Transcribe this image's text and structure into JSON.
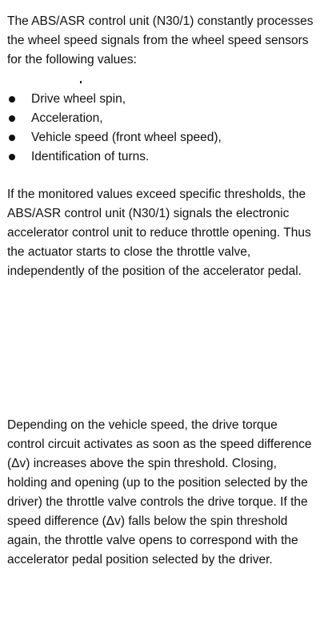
{
  "document": {
    "intro": "The ABS/ASR control unit (N30/1) constantly processes the wheel speed signals from the wheel speed sensors for the following values:",
    "bullets": [
      "Drive wheel spin,",
      "Acceleration,",
      "Vehicle speed (front wheel speed),",
      "Identification of turns."
    ],
    "paragraph2": "If the monitored values exceed specific thresholds, the ABS/ASR control unit (N30/1) signals the electronic accelerator control unit to reduce throttle opening. Thus the actuator starts to close the throttle valve, independently of the position of the accelerator pedal.",
    "paragraph3": "Depending on the vehicle speed, the drive torque control circuit activates as soon as the speed difference (Δv) increases above the spin threshold. Closing, holding and opening (up to the position selected by the driver) the throttle valve controls the drive torque. If the speed difference (Δv) falls below the spin threshold again, the throttle valve opens to correspond with the accelerator pedal position selected by the driver."
  }
}
